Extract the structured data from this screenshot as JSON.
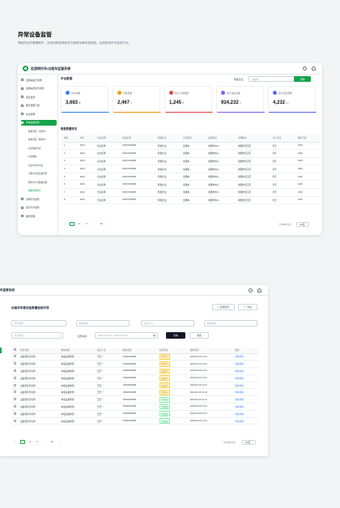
{
  "section": {
    "title": "异常设备监管",
    "desc": "驾驶员证件管理维护，支持司机或驾驶员与使用车辆车型校验，社统查询不开放流行为。"
  },
  "app": {
    "title": "巡游网约车/出租车监管系统",
    "sidebar": [
      {
        "label": "出租车运行监测",
        "type": "item"
      },
      {
        "label": "出租车经营方监测",
        "type": "item"
      },
      {
        "label": "运营监测",
        "type": "item"
      },
      {
        "label": "服务质量下发",
        "type": "item"
      },
      {
        "label": "执法管理",
        "type": "item"
      },
      {
        "label": "异常设备监管",
        "type": "active"
      },
      {
        "label": "数据质量（出租车）",
        "type": "sub"
      },
      {
        "label": "数据质量（网约车）",
        "type": "sub"
      },
      {
        "label": "轨迹数据列表",
        "type": "sub"
      },
      {
        "label": "轨迹数据",
        "type": "sub"
      },
      {
        "label": "轨迹异常车列表",
        "type": "sub"
      },
      {
        "label": "出租车车载设备管理",
        "type": "sub"
      },
      {
        "label": "网约车平台数据质量",
        "type": "sub"
      },
      {
        "label": "数据质量排名",
        "type": "selsub"
      },
      {
        "label": "文明行为监管",
        "type": "item"
      },
      {
        "label": "运行行为监管",
        "type": "item"
      },
      {
        "label": "稽查管理",
        "type": "item"
      }
    ],
    "main": {
      "page_title": "平台数据",
      "filter_label": "所属企业",
      "filter_placeholder": "请选择",
      "query_button": "查询",
      "cards": [
        {
          "label": "平台车辆",
          "value": "3,683",
          "unit": "辆",
          "color": "#3b82f6"
        },
        {
          "label": "驾驶员数",
          "value": "2,467",
          "unit": "人",
          "color": "#f59e0b"
        },
        {
          "label": "累计订单数量",
          "value": "1,245",
          "unit": "单",
          "color": "#ef4444"
        },
        {
          "label": "累计营运金额",
          "value": "924,232",
          "unit": "元",
          "color": "#8b5cf6"
        },
        {
          "label": "累计营运里程",
          "value": "4,232",
          "unit": "km",
          "color": "#6366f1"
        }
      ],
      "table_title": "数据质量排名",
      "columns": [
        "排名",
        "年份",
        "企业名称",
        "营业执照",
        "所属企业",
        "企业类型",
        "设置地址",
        "详细地址",
        "法人代表",
        "联系方式"
      ],
      "rows": [
        [
          "1",
          "2024",
          "企业名称",
          "1503733092B",
          "所属企业",
          "出租车",
          "成都市中心",
          "成都市锦江区",
          "孙艺",
          "1345"
        ],
        [
          "2",
          "2024",
          "企业名称",
          "1503733092B",
          "所属企业",
          "出租车",
          "成都市中心",
          "成都市锦江区",
          "孙艺",
          "1345"
        ],
        [
          "3",
          "2024",
          "企业名称",
          "1503733092B",
          "所属企业",
          "出租车",
          "成都市中心",
          "成都市锦江区",
          "孙艺",
          "1345"
        ],
        [
          "4",
          "2024",
          "企业名称",
          "1503733092B",
          "所属企业",
          "出租车",
          "成都市中心",
          "成都市锦江区",
          "孙艺",
          "1345"
        ],
        [
          "5",
          "2024",
          "企业名称",
          "1503733092B",
          "所属企业",
          "出租车",
          "成都市中心",
          "成都市锦江区",
          "孙艺",
          "1345"
        ],
        [
          "6",
          "2024",
          "企业名称",
          "1503733092B",
          "所属企业",
          "出租车",
          "成都市中心",
          "成都市锦江区",
          "孙艺",
          "1345"
        ],
        [
          "7",
          "2024",
          "企业名称",
          "1503733092B",
          "所属企业",
          "出租车",
          "成都市中心",
          "成都市锦江区",
          "孙艺",
          "1345"
        ],
        [
          "8",
          "2024",
          "企业名称",
          "1503733092B",
          "所属企业",
          "出租车",
          "成都市中心",
          "成都市锦江区",
          "孙艺",
          "1345"
        ]
      ],
      "pagination": {
        "pages": [
          "1",
          "2",
          "3",
          "...",
          "10"
        ],
        "total": "共100条记录",
        "per_page": "10/页"
      }
    }
  },
  "app2": {
    "header_title": "车监管系统",
    "page_title": "出租车车载设备数量检验列表",
    "add_button": "新增任务",
    "export_button": "导出",
    "filters": {
      "task_name": "任务名称",
      "check_item": "检验事项",
      "executor": "执法人员",
      "contact": "联系电话",
      "status": "任务状态",
      "time_label": "任务时间",
      "time_value": "2023-12-12 00 - 2023-12-12 00",
      "search_button": "查询",
      "reset_button": "重置"
    },
    "columns": [
      "任务名称",
      "检验事项",
      "执法人员",
      "联系电话",
      "任务状态",
      "期间时间",
      "操作"
    ],
    "rows": [
      [
        "设备量任务名称",
        "车载设备检测",
        "王天一",
        "13540623938",
        "进行中",
        "2024.02.23 12:12",
        "查看详情"
      ],
      [
        "设备量任务名称",
        "车载设备检测",
        "王天一",
        "13540623938",
        "进行中",
        "2024.02.23 12:12",
        "查看详情"
      ],
      [
        "设备量任务名称",
        "车载设备检测",
        "王天一",
        "13540623938",
        "进行中",
        "2024.02.23 12:12",
        "查看详情"
      ],
      [
        "设备量任务名称",
        "车载设备检测",
        "王天一",
        "13540623938",
        "进行中",
        "2024.02.23 12:12",
        "查看详情"
      ],
      [
        "设备量任务名称",
        "车载设备检测",
        "王天一",
        "13540623938",
        "进行中",
        "2024.02.23 12:12",
        "查看详情"
      ],
      [
        "设备量任务名称",
        "车载设备检测",
        "王天一",
        "13540623938",
        "进行中",
        "2024.02.23 12:12",
        "查看详情"
      ],
      [
        "设备量任务名称",
        "车载设备检测",
        "王天一",
        "13540623938",
        "已完成",
        "2024.02.23 12:12",
        "查看详情"
      ],
      [
        "设备量任务名称",
        "车载设备检测",
        "王天一",
        "13540623938",
        "已完成",
        "2024.02.23 12:12",
        "查看详情"
      ],
      [
        "设备量任务名称",
        "车载设备检测",
        "王天一",
        "13540623938",
        "已完成",
        "2024.02.23 12:12",
        "查看详情"
      ],
      [
        "设备量任务名称",
        "车载设备检测",
        "王天一",
        "13540623938",
        "已完成",
        "2024.02.23 12:12",
        "查看详情"
      ]
    ],
    "pagination": {
      "pages": [
        "1",
        "2",
        "3",
        "...",
        "10"
      ],
      "total": "共100条记录",
      "per_page": "10/页"
    }
  }
}
